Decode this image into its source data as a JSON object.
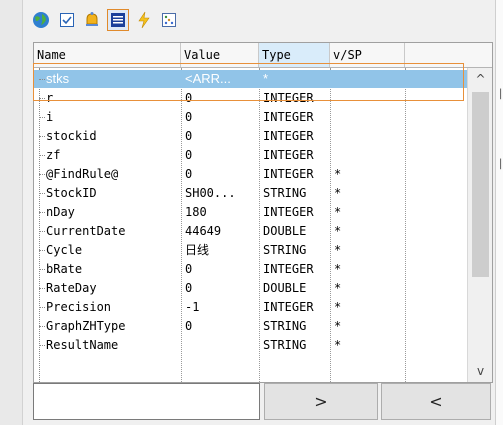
{
  "toolbar": {
    "buttons": [
      {
        "icon": "globe-icon",
        "selected": false
      },
      {
        "icon": "document-check-icon",
        "selected": false
      },
      {
        "icon": "bell-icon",
        "selected": false
      },
      {
        "icon": "list-view-icon",
        "selected": true
      },
      {
        "icon": "lightning-icon",
        "selected": false
      },
      {
        "icon": "grid-dots-icon",
        "selected": false
      }
    ]
  },
  "grid": {
    "columns": [
      "Name",
      "Value",
      "Type",
      "v/SP"
    ],
    "rows": [
      {
        "name": "stks",
        "value": "<ARR...",
        "type": "*",
        "vsp": "",
        "selected": true
      },
      {
        "name": "r",
        "value": "0",
        "type": "INTEGER",
        "vsp": ""
      },
      {
        "name": "i",
        "value": "0",
        "type": "INTEGER",
        "vsp": ""
      },
      {
        "name": "stockid",
        "value": "0",
        "type": "INTEGER",
        "vsp": ""
      },
      {
        "name": "zf",
        "value": "0",
        "type": "INTEGER",
        "vsp": ""
      },
      {
        "name": "@FindRule@",
        "value": "0",
        "type": "INTEGER",
        "vsp": "*"
      },
      {
        "name": "StockID",
        "value": "SH00...",
        "type": "STRING",
        "vsp": "*"
      },
      {
        "name": "nDay",
        "value": "180",
        "type": "INTEGER",
        "vsp": "*"
      },
      {
        "name": "CurrentDate",
        "value": "44649",
        "type": "DOUBLE",
        "vsp": "*"
      },
      {
        "name": "Cycle",
        "value": "日线",
        "type": "STRING",
        "vsp": "*"
      },
      {
        "name": "bRate",
        "value": "0",
        "type": "INTEGER",
        "vsp": "*"
      },
      {
        "name": "RateDay",
        "value": "0",
        "type": "DOUBLE",
        "vsp": "*"
      },
      {
        "name": "Precision",
        "value": "-1",
        "type": "INTEGER",
        "vsp": "*"
      },
      {
        "name": "GraphZHType",
        "value": "0",
        "type": "STRING",
        "vsp": "*"
      },
      {
        "name": "ResultName",
        "value": "",
        "type": "STRING",
        "vsp": "*"
      }
    ],
    "scroll_up": "^",
    "scroll_down": "v"
  },
  "bottom": {
    "input_value": "",
    "next_label": ">",
    "prev_label": "<"
  },
  "colors": {
    "selection": "#91c4e8",
    "highlight_border": "#e8903a"
  }
}
